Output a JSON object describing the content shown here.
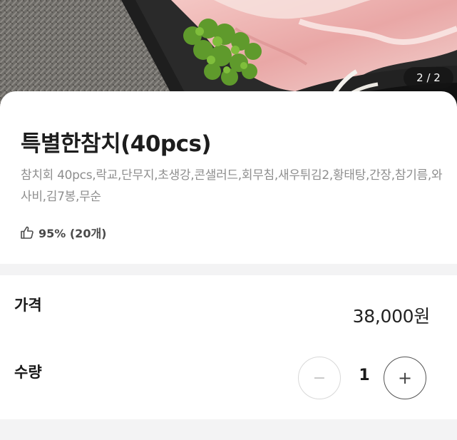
{
  "hero": {
    "page_indicator": "2 / 2"
  },
  "product": {
    "title": "특별한참치(40pcs)",
    "description": "참치회 40pcs,락교,단무지,초생강,콘샐러드,회무침,새우튀김2,황태탕,간장,참기름,와사비,김7봉,무순",
    "rating": "95% (20개)"
  },
  "order": {
    "price_label": "가격",
    "price": "38,000원",
    "quantity_label": "수량",
    "quantity": "1",
    "minus_symbol": "−",
    "plus_symbol": "+"
  },
  "colors": {
    "background": "#ffffff",
    "divider": "#f3f3f4",
    "description_text": "#8e8e8e",
    "title_text": "#1d1d1d",
    "minus_border": "#d9d9d9",
    "plus_border": "#555555"
  },
  "icons": [
    "thumbs-up-icon",
    "minus-icon",
    "plus-icon"
  ]
}
